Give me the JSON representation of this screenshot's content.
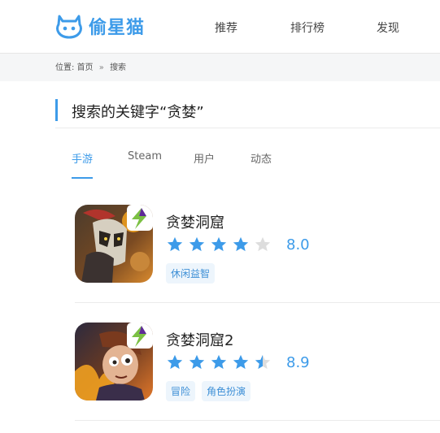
{
  "header": {
    "logo_text": "偷星猫",
    "nav": [
      "推荐",
      "排行榜",
      "发现"
    ]
  },
  "breadcrumb": {
    "prefix": "位置:",
    "home": "首页",
    "separator": "»",
    "current": "搜索"
  },
  "search": {
    "title": "搜索的关键字“贪婪”"
  },
  "tabs": [
    "手游",
    "Steam",
    "用户",
    "动态"
  ],
  "active_tab": 0,
  "games": [
    {
      "name": "贪婪洞窟",
      "stars": 4,
      "rating": "8.0",
      "tags": [
        "休闲益智"
      ]
    },
    {
      "name": "贪婪洞窟2",
      "stars": 4.5,
      "rating": "8.9",
      "tags": [
        "冒险",
        "角色扮演"
      ]
    }
  ],
  "colors": {
    "accent": "#3d9be9",
    "star_empty": "#dddddd",
    "tag_bg": "#edf5fc"
  }
}
